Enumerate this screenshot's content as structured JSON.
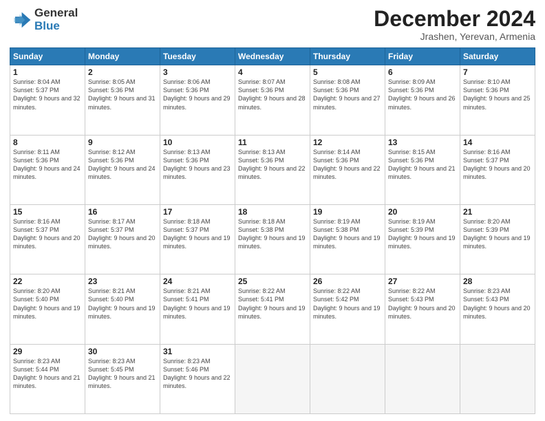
{
  "logo": {
    "general": "General",
    "blue": "Blue"
  },
  "header": {
    "month": "December 2024",
    "location": "Jrashen, Yerevan, Armenia"
  },
  "days_of_week": [
    "Sunday",
    "Monday",
    "Tuesday",
    "Wednesday",
    "Thursday",
    "Friday",
    "Saturday"
  ],
  "weeks": [
    [
      {
        "day": "1",
        "sunrise": "Sunrise: 8:04 AM",
        "sunset": "Sunset: 5:37 PM",
        "daylight": "Daylight: 9 hours and 32 minutes."
      },
      {
        "day": "2",
        "sunrise": "Sunrise: 8:05 AM",
        "sunset": "Sunset: 5:36 PM",
        "daylight": "Daylight: 9 hours and 31 minutes."
      },
      {
        "day": "3",
        "sunrise": "Sunrise: 8:06 AM",
        "sunset": "Sunset: 5:36 PM",
        "daylight": "Daylight: 9 hours and 29 minutes."
      },
      {
        "day": "4",
        "sunrise": "Sunrise: 8:07 AM",
        "sunset": "Sunset: 5:36 PM",
        "daylight": "Daylight: 9 hours and 28 minutes."
      },
      {
        "day": "5",
        "sunrise": "Sunrise: 8:08 AM",
        "sunset": "Sunset: 5:36 PM",
        "daylight": "Daylight: 9 hours and 27 minutes."
      },
      {
        "day": "6",
        "sunrise": "Sunrise: 8:09 AM",
        "sunset": "Sunset: 5:36 PM",
        "daylight": "Daylight: 9 hours and 26 minutes."
      },
      {
        "day": "7",
        "sunrise": "Sunrise: 8:10 AM",
        "sunset": "Sunset: 5:36 PM",
        "daylight": "Daylight: 9 hours and 25 minutes."
      }
    ],
    [
      {
        "day": "8",
        "sunrise": "Sunrise: 8:11 AM",
        "sunset": "Sunset: 5:36 PM",
        "daylight": "Daylight: 9 hours and 24 minutes."
      },
      {
        "day": "9",
        "sunrise": "Sunrise: 8:12 AM",
        "sunset": "Sunset: 5:36 PM",
        "daylight": "Daylight: 9 hours and 24 minutes."
      },
      {
        "day": "10",
        "sunrise": "Sunrise: 8:13 AM",
        "sunset": "Sunset: 5:36 PM",
        "daylight": "Daylight: 9 hours and 23 minutes."
      },
      {
        "day": "11",
        "sunrise": "Sunrise: 8:13 AM",
        "sunset": "Sunset: 5:36 PM",
        "daylight": "Daylight: 9 hours and 22 minutes."
      },
      {
        "day": "12",
        "sunrise": "Sunrise: 8:14 AM",
        "sunset": "Sunset: 5:36 PM",
        "daylight": "Daylight: 9 hours and 22 minutes."
      },
      {
        "day": "13",
        "sunrise": "Sunrise: 8:15 AM",
        "sunset": "Sunset: 5:36 PM",
        "daylight": "Daylight: 9 hours and 21 minutes."
      },
      {
        "day": "14",
        "sunrise": "Sunrise: 8:16 AM",
        "sunset": "Sunset: 5:37 PM",
        "daylight": "Daylight: 9 hours and 20 minutes."
      }
    ],
    [
      {
        "day": "15",
        "sunrise": "Sunrise: 8:16 AM",
        "sunset": "Sunset: 5:37 PM",
        "daylight": "Daylight: 9 hours and 20 minutes."
      },
      {
        "day": "16",
        "sunrise": "Sunrise: 8:17 AM",
        "sunset": "Sunset: 5:37 PM",
        "daylight": "Daylight: 9 hours and 20 minutes."
      },
      {
        "day": "17",
        "sunrise": "Sunrise: 8:18 AM",
        "sunset": "Sunset: 5:37 PM",
        "daylight": "Daylight: 9 hours and 19 minutes."
      },
      {
        "day": "18",
        "sunrise": "Sunrise: 8:18 AM",
        "sunset": "Sunset: 5:38 PM",
        "daylight": "Daylight: 9 hours and 19 minutes."
      },
      {
        "day": "19",
        "sunrise": "Sunrise: 8:19 AM",
        "sunset": "Sunset: 5:38 PM",
        "daylight": "Daylight: 9 hours and 19 minutes."
      },
      {
        "day": "20",
        "sunrise": "Sunrise: 8:19 AM",
        "sunset": "Sunset: 5:39 PM",
        "daylight": "Daylight: 9 hours and 19 minutes."
      },
      {
        "day": "21",
        "sunrise": "Sunrise: 8:20 AM",
        "sunset": "Sunset: 5:39 PM",
        "daylight": "Daylight: 9 hours and 19 minutes."
      }
    ],
    [
      {
        "day": "22",
        "sunrise": "Sunrise: 8:20 AM",
        "sunset": "Sunset: 5:40 PM",
        "daylight": "Daylight: 9 hours and 19 minutes."
      },
      {
        "day": "23",
        "sunrise": "Sunrise: 8:21 AM",
        "sunset": "Sunset: 5:40 PM",
        "daylight": "Daylight: 9 hours and 19 minutes."
      },
      {
        "day": "24",
        "sunrise": "Sunrise: 8:21 AM",
        "sunset": "Sunset: 5:41 PM",
        "daylight": "Daylight: 9 hours and 19 minutes."
      },
      {
        "day": "25",
        "sunrise": "Sunrise: 8:22 AM",
        "sunset": "Sunset: 5:41 PM",
        "daylight": "Daylight: 9 hours and 19 minutes."
      },
      {
        "day": "26",
        "sunrise": "Sunrise: 8:22 AM",
        "sunset": "Sunset: 5:42 PM",
        "daylight": "Daylight: 9 hours and 19 minutes."
      },
      {
        "day": "27",
        "sunrise": "Sunrise: 8:22 AM",
        "sunset": "Sunset: 5:43 PM",
        "daylight": "Daylight: 9 hours and 20 minutes."
      },
      {
        "day": "28",
        "sunrise": "Sunrise: 8:23 AM",
        "sunset": "Sunset: 5:43 PM",
        "daylight": "Daylight: 9 hours and 20 minutes."
      }
    ],
    [
      {
        "day": "29",
        "sunrise": "Sunrise: 8:23 AM",
        "sunset": "Sunset: 5:44 PM",
        "daylight": "Daylight: 9 hours and 21 minutes."
      },
      {
        "day": "30",
        "sunrise": "Sunrise: 8:23 AM",
        "sunset": "Sunset: 5:45 PM",
        "daylight": "Daylight: 9 hours and 21 minutes."
      },
      {
        "day": "31",
        "sunrise": "Sunrise: 8:23 AM",
        "sunset": "Sunset: 5:46 PM",
        "daylight": "Daylight: 9 hours and 22 minutes."
      },
      null,
      null,
      null,
      null
    ]
  ]
}
